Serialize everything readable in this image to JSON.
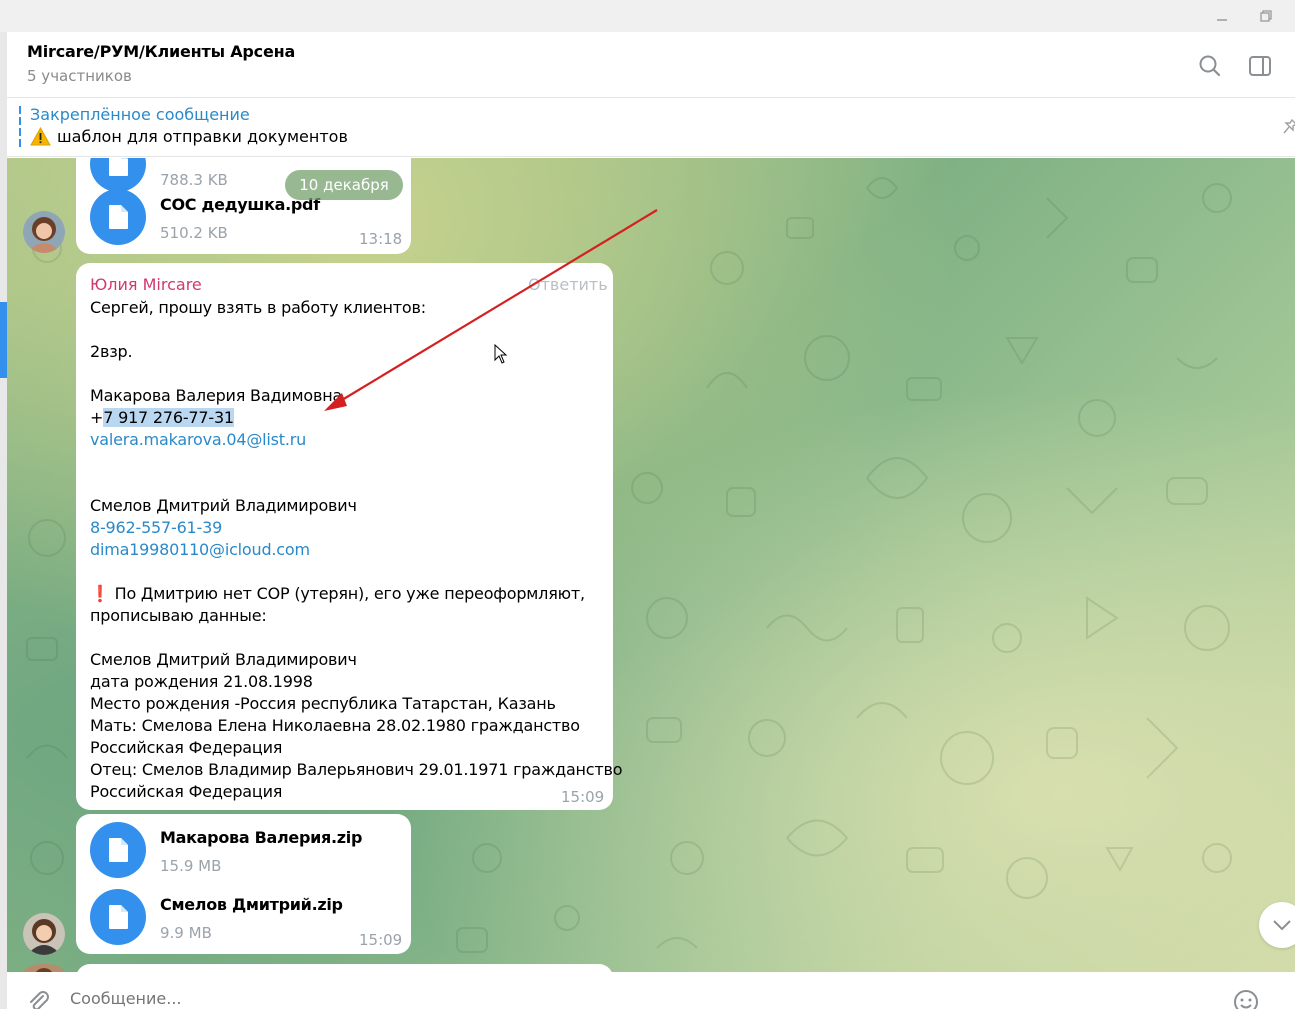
{
  "window": {
    "minimize_icon": "minimize-icon",
    "restore_icon": "restore-icon"
  },
  "header": {
    "title": "Mircare/РУМ/Клиенты Арсена",
    "subtitle": "5 участников",
    "search_icon": "search-icon",
    "sidebar_icon": "sidebar-toggle-icon"
  },
  "pinned": {
    "title": "Закреплённое сообщение",
    "text": "шаблон для отправки документов",
    "icon": "warning-icon"
  },
  "chat": {
    "date_pill": "10 декабря",
    "first_bubble": {
      "files": [
        {
          "name": "",
          "size": "788.3 KB"
        },
        {
          "name": "СОС дедушка.pdf",
          "size": "510.2 KB"
        }
      ],
      "time": "13:18"
    },
    "message": {
      "sender": "Юлия Mircare",
      "reply_label": "Ответить",
      "lines": [
        "Сергей, прошу взять в работу клиентов:",
        "",
        "2взр.",
        "",
        "Макарова Валерия Вадимовна",
        "+7 917 276-77-31",
        "valera.makarova.04@list.ru",
        "",
        "",
        "Смелов Дмитрий Владимирович",
        "8-962-557-61-39",
        "dima19980110@icloud.com",
        "",
        "❗ По Дмитрию нет СОР (утерян), его  уже переоформляют,",
        "прописываю данные:",
        "",
        "Смелов Дмитрий Владимирович",
        "дата рождения 21.08.1998",
        "Место рождения -Россия республика Татарстан, Казань",
        "Мать: Смелова Елена Николаевна 28.02.1980  гражданство",
        "Российская Федерация",
        "Отец: Смелов Владимир Валерьянович 29.01.1971 гражданство",
        "Российская Федерация"
      ],
      "phone_prefix": "+",
      "phone_highlight": "7 917 276-77-31",
      "time": "15:09"
    },
    "files_bubble": {
      "files": [
        {
          "name": "Макарова Валерия.zip",
          "size": "15.9 MB"
        },
        {
          "name": "Смелов Дмитрий.zip",
          "size": "9.9 MB"
        }
      ],
      "time": "15:09"
    },
    "annotation": {
      "color": "#d42020"
    },
    "scroll_icon": "chevron-down-icon"
  },
  "composer": {
    "placeholder": "Сообщение...",
    "attach_icon": "paperclip-icon",
    "emoji_icon": "emoji-icon"
  },
  "colors": {
    "accent": "#3390ec",
    "sender": "#d0396f",
    "link": "#2a8ac9"
  }
}
